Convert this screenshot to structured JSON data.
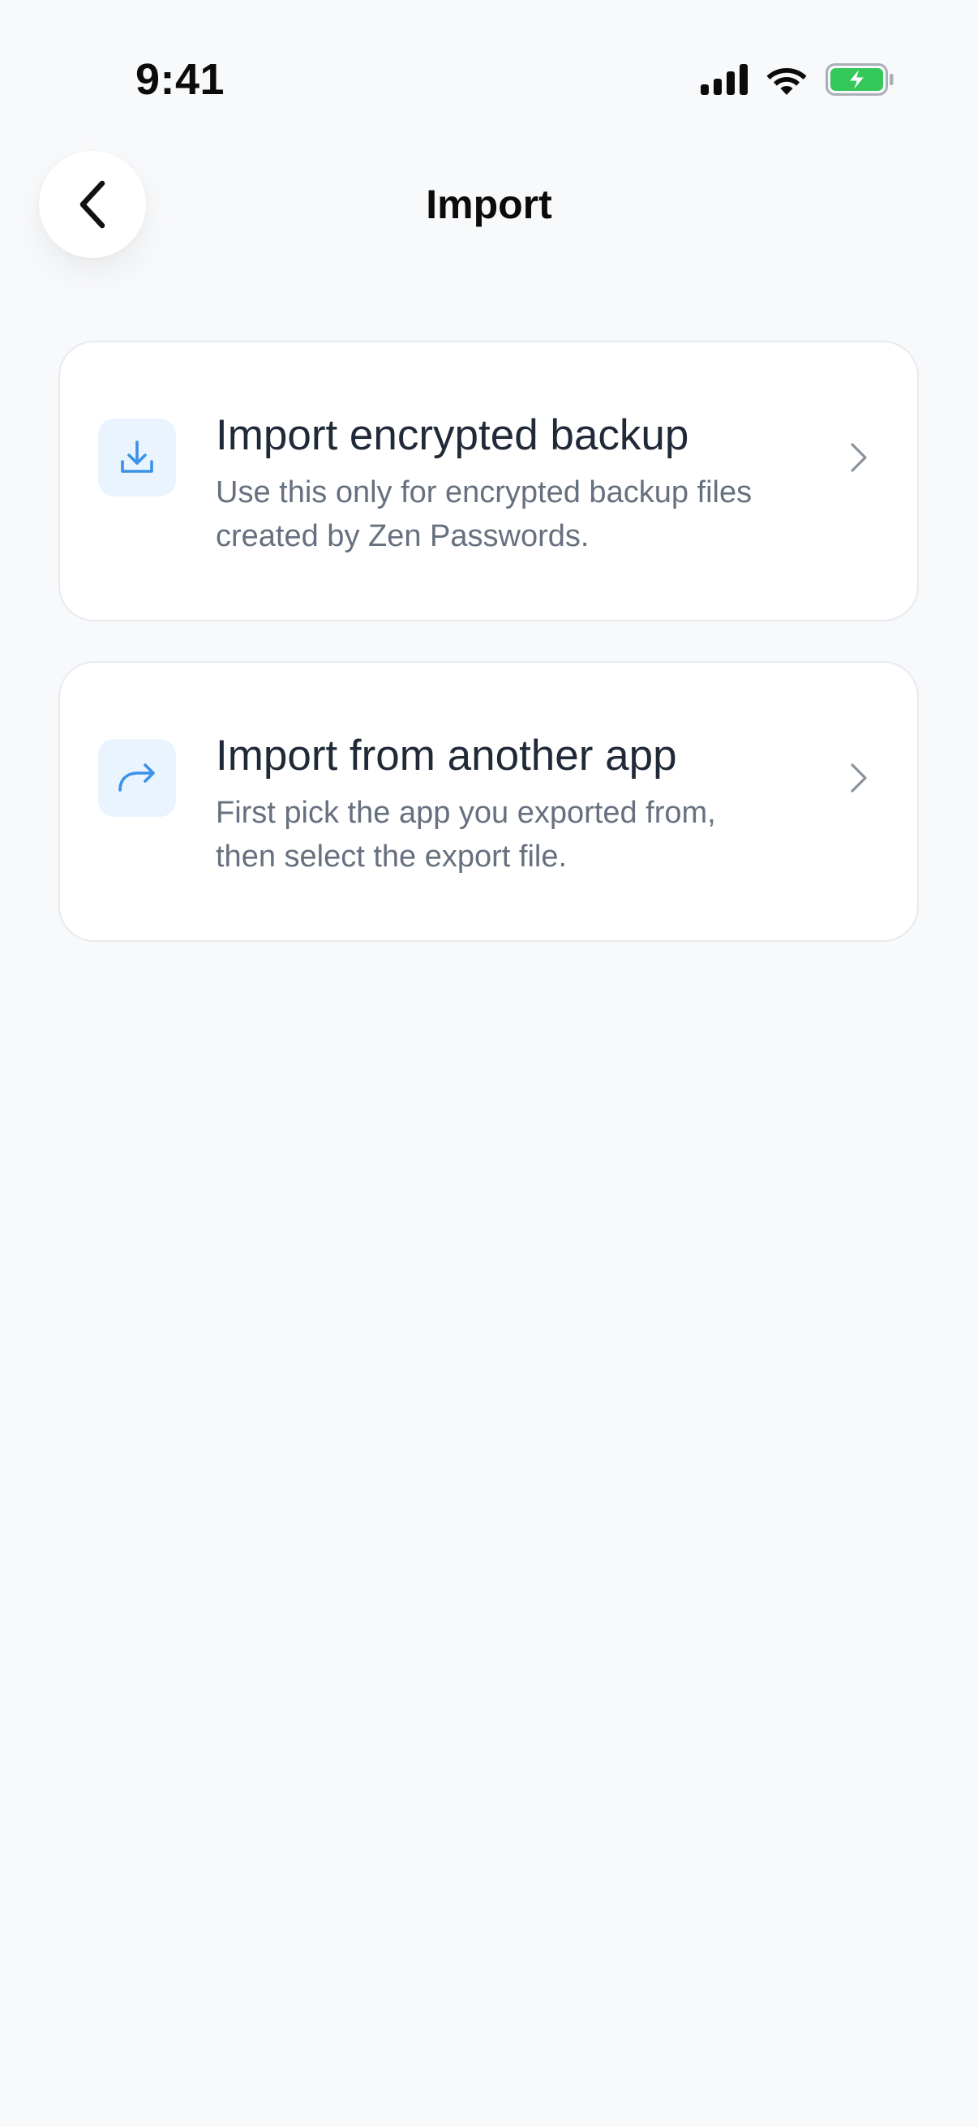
{
  "status_bar": {
    "time": "9:41",
    "icons": [
      "signal-icon",
      "wifi-icon",
      "battery-charging-icon"
    ]
  },
  "header": {
    "back_icon": "chevron-left-icon",
    "title": "Import"
  },
  "options": [
    {
      "icon": "download-icon",
      "title": "Import encrypted backup",
      "description": "Use this only for encrypted backup files created by Zen Passwords."
    },
    {
      "icon": "share-arrow-icon",
      "title": "Import from another app",
      "description": "First pick the app you exported from, then select the export file."
    }
  ],
  "colors": {
    "background": "#f8f9fb",
    "card": "#ffffff",
    "accent": "#3b92e8",
    "icon_bg": "#eaf4fe",
    "title_text": "#1f2937",
    "description_text": "#66707f",
    "battery": "#34c759"
  }
}
